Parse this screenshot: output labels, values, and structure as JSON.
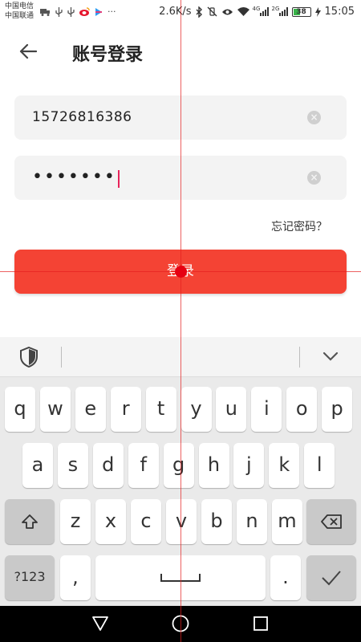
{
  "status_bar": {
    "carrier_1": "中国电信",
    "carrier_2": "中国联通",
    "icons_left": [
      "truck-icon",
      "usb-icon",
      "usb-icon",
      "weibo-icon",
      "arrow-app-icon",
      "more-icon"
    ],
    "more": "···",
    "net_speed": "2.6K/s",
    "icons_right": [
      "bluetooth-icon",
      "vibrate-off-icon",
      "eye-icon",
      "wifi-icon",
      "signal-4g-icon",
      "signal-2g-icon"
    ],
    "signal_1_tag": "4G",
    "signal_2_tag": "2G",
    "battery": "38",
    "time": "15:05"
  },
  "app_bar": {
    "back_icon": "arrow-left-icon",
    "title": "账号登录"
  },
  "form": {
    "phone_value": "15726816386",
    "password_mask": "•••••••",
    "clear_icon": "clear-circle-icon",
    "forgot_password": "忘记密码？",
    "login_button": "登录"
  },
  "keyboard": {
    "toolbar_icons": [
      "shield-icon",
      "chevron-down-icon"
    ],
    "row1": [
      "q",
      "w",
      "e",
      "r",
      "t",
      "y",
      "u",
      "i",
      "o",
      "p"
    ],
    "row2": [
      "a",
      "s",
      "d",
      "f",
      "g",
      "h",
      "j",
      "k",
      "l"
    ],
    "row3": [
      "z",
      "x",
      "c",
      "v",
      "b",
      "n",
      "m"
    ],
    "symbols_key": "?123",
    "comma_key": ",",
    "period_key": ".",
    "shift_icon": "shift-icon",
    "backspace_icon": "backspace-icon",
    "space_icon": "space-icon",
    "enter_icon": "check-icon"
  },
  "nav_bar": {
    "icons": [
      "back-triangle-icon",
      "home-circle-icon",
      "recents-square-icon"
    ]
  },
  "colors": {
    "accent": "#f44334",
    "caret": "#e8245a",
    "overlay": "#e60012"
  }
}
